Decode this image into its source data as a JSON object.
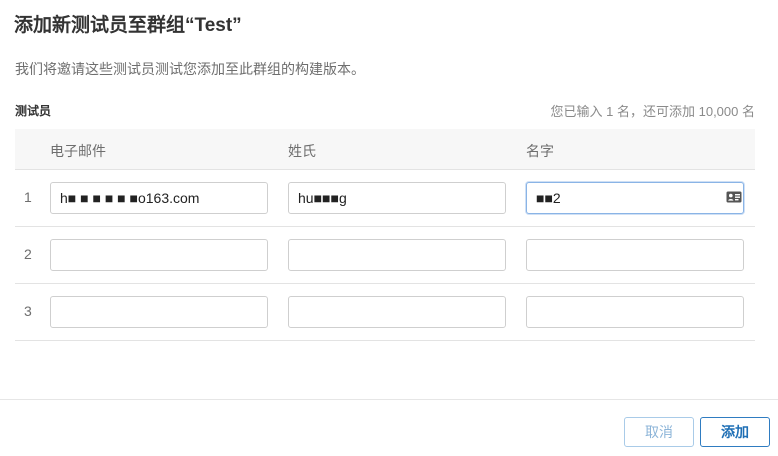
{
  "dialog": {
    "title": "添加新测试员至群组“Test”",
    "description": "我们将邀请这些测试员测试您添加至此群组的构建版本。",
    "section_label": "测试员",
    "count_note": "您已输入 1 名，还可添加 10,000 名"
  },
  "table": {
    "headers": [
      "电子邮件",
      "姓氏",
      "名字"
    ],
    "rows": [
      {
        "num": "1",
        "email": "h■ ■ ■ ■ ■ ■o163.com",
        "last_name": "hu■■■g",
        "first_name": "■■2"
      },
      {
        "num": "2",
        "email": "",
        "last_name": "",
        "first_name": ""
      },
      {
        "num": "3",
        "email": "",
        "last_name": "",
        "first_name": ""
      }
    ],
    "contact_icon": "contact-card-icon"
  },
  "footer": {
    "cancel_label": "取消",
    "add_label": "添加"
  },
  "colors": {
    "accent": "#1f6fb5",
    "cancel_text": "#8cb4d8",
    "header_bg": "#f7f7f7"
  }
}
